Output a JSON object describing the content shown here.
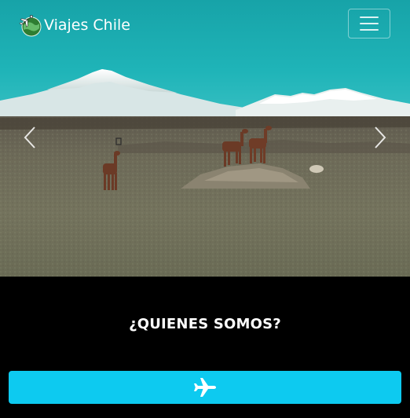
{
  "navbar": {
    "brand_name": "Viajes Chile",
    "logo_icon": "globe-plane-icon",
    "toggler_icon": "hamburger-menu-icon"
  },
  "carousel": {
    "slide_description_icon": "llamas-altiplano-photo",
    "prev_icon": "chevron-left-icon",
    "next_icon": "chevron-right-icon"
  },
  "about": {
    "title": "¿QUIENES SOMOS?",
    "button_icon": "airplane-icon",
    "button_color": "#0dcaf0"
  }
}
